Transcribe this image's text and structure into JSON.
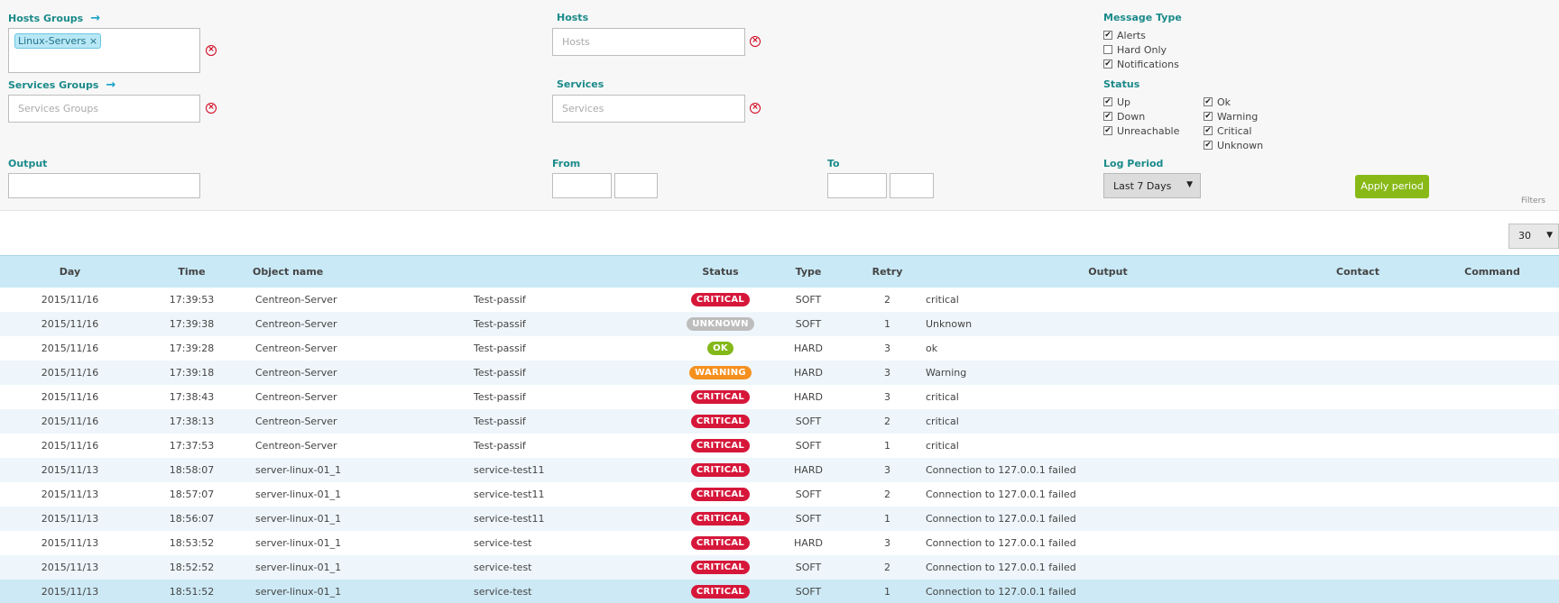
{
  "filters": {
    "hosts_groups": {
      "label": "Hosts Groups",
      "arrow": "→",
      "tags": [
        "Linux-Servers"
      ],
      "tag_remove": "×"
    },
    "hosts": {
      "label": "Hosts",
      "placeholder": "Hosts"
    },
    "services_groups": {
      "label": "Services Groups",
      "arrow": "→",
      "placeholder": "Services Groups"
    },
    "services": {
      "label": "Services",
      "placeholder": "Services"
    },
    "output": {
      "label": "Output",
      "value": ""
    },
    "from": {
      "label": "From",
      "date": "",
      "time": ""
    },
    "to": {
      "label": "To",
      "date": "",
      "time": ""
    },
    "message_type": {
      "label": "Message Type",
      "options": [
        {
          "label": "Alerts",
          "checked": true
        },
        {
          "label": "Hard Only",
          "checked": false
        },
        {
          "label": "Notifications",
          "checked": true
        }
      ]
    },
    "status": {
      "label": "Status",
      "host_options": [
        {
          "label": "Up",
          "checked": true
        },
        {
          "label": "Down",
          "checked": true
        },
        {
          "label": "Unreachable",
          "checked": true
        }
      ],
      "service_options": [
        {
          "label": "Ok",
          "checked": true
        },
        {
          "label": "Warning",
          "checked": true
        },
        {
          "label": "Critical",
          "checked": true
        },
        {
          "label": "Unknown",
          "checked": true
        }
      ]
    },
    "log_period": {
      "label": "Log Period",
      "selected": "Last 7 Days"
    },
    "apply_label": "Apply period",
    "filters_tag": "Filters"
  },
  "pagination": {
    "per_page": "30"
  },
  "colors": {
    "critical": "#d6173a",
    "unknown": "#bdbdbd",
    "ok": "#84b819",
    "warning": "#f5901e",
    "accent": "#1b8a8a"
  },
  "table": {
    "headers": {
      "day": "Day",
      "time": "Time",
      "object": "Object name",
      "status": "Status",
      "type": "Type",
      "retry": "Retry",
      "output": "Output",
      "contact": "Contact",
      "command": "Command"
    },
    "rows": [
      {
        "day": "2015/11/16",
        "time": "17:39:53",
        "host": "Centreon-Server",
        "service": "Test-passif",
        "status": "CRITICAL",
        "status_key": "critical",
        "type": "SOFT",
        "retry": "2",
        "output": "critical"
      },
      {
        "day": "2015/11/16",
        "time": "17:39:38",
        "host": "Centreon-Server",
        "service": "Test-passif",
        "status": "UNKNOWN",
        "status_key": "unknown",
        "type": "SOFT",
        "retry": "1",
        "output": "Unknown"
      },
      {
        "day": "2015/11/16",
        "time": "17:39:28",
        "host": "Centreon-Server",
        "service": "Test-passif",
        "status": "OK",
        "status_key": "ok",
        "type": "HARD",
        "retry": "3",
        "output": "ok"
      },
      {
        "day": "2015/11/16",
        "time": "17:39:18",
        "host": "Centreon-Server",
        "service": "Test-passif",
        "status": "WARNING",
        "status_key": "warning",
        "type": "HARD",
        "retry": "3",
        "output": "Warning"
      },
      {
        "day": "2015/11/16",
        "time": "17:38:43",
        "host": "Centreon-Server",
        "service": "Test-passif",
        "status": "CRITICAL",
        "status_key": "critical",
        "type": "HARD",
        "retry": "3",
        "output": "critical"
      },
      {
        "day": "2015/11/16",
        "time": "17:38:13",
        "host": "Centreon-Server",
        "service": "Test-passif",
        "status": "CRITICAL",
        "status_key": "critical",
        "type": "SOFT",
        "retry": "2",
        "output": "critical"
      },
      {
        "day": "2015/11/16",
        "time": "17:37:53",
        "host": "Centreon-Server",
        "service": "Test-passif",
        "status": "CRITICAL",
        "status_key": "critical",
        "type": "SOFT",
        "retry": "1",
        "output": "critical"
      },
      {
        "day": "2015/11/13",
        "time": "18:58:07",
        "host": "server-linux-01_1",
        "service": "service-test11",
        "status": "CRITICAL",
        "status_key": "critical",
        "type": "HARD",
        "retry": "3",
        "output": "Connection to 127.0.0.1 failed"
      },
      {
        "day": "2015/11/13",
        "time": "18:57:07",
        "host": "server-linux-01_1",
        "service": "service-test11",
        "status": "CRITICAL",
        "status_key": "critical",
        "type": "SOFT",
        "retry": "2",
        "output": "Connection to 127.0.0.1 failed"
      },
      {
        "day": "2015/11/13",
        "time": "18:56:07",
        "host": "server-linux-01_1",
        "service": "service-test11",
        "status": "CRITICAL",
        "status_key": "critical",
        "type": "SOFT",
        "retry": "1",
        "output": "Connection to 127.0.0.1 failed"
      },
      {
        "day": "2015/11/13",
        "time": "18:53:52",
        "host": "server-linux-01_1",
        "service": "service-test",
        "status": "CRITICAL",
        "status_key": "critical",
        "type": "HARD",
        "retry": "3",
        "output": "Connection to 127.0.0.1 failed"
      },
      {
        "day": "2015/11/13",
        "time": "18:52:52",
        "host": "server-linux-01_1",
        "service": "service-test",
        "status": "CRITICAL",
        "status_key": "critical",
        "type": "SOFT",
        "retry": "2",
        "output": "Connection to 127.0.0.1 failed"
      },
      {
        "day": "2015/11/13",
        "time": "18:51:52",
        "host": "server-linux-01_1",
        "service": "service-test",
        "status": "CRITICAL",
        "status_key": "critical",
        "type": "SOFT",
        "retry": "1",
        "output": "Connection to 127.0.0.1 failed"
      }
    ]
  }
}
